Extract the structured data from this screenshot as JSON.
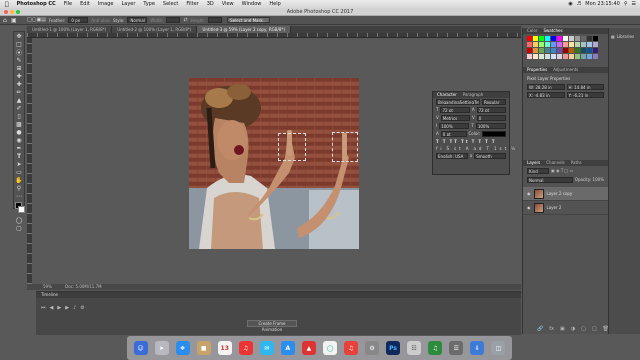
{
  "menubar": {
    "apple": "",
    "app": "Photoshop CC",
    "items": [
      "File",
      "Edit",
      "Image",
      "Layer",
      "Type",
      "Select",
      "Filter",
      "3D",
      "View",
      "Window",
      "Help"
    ],
    "clock": "Mon 23:15:40"
  },
  "titlebar": {
    "title": "Adobe Photoshop CC 2017"
  },
  "options": {
    "feather_label": "Feather:",
    "feather_value": "0 px",
    "antialias": "Anti-alias",
    "style_label": "Style:",
    "style_value": "Normal",
    "width_label": "Width:",
    "height_label": "Height:",
    "select_mask": "Select and Mask..."
  },
  "tabs": [
    {
      "label": "Untitled-1 @ 100% (Layer 1, RGB/8*)"
    },
    {
      "label": "Untitled-2 @ 100% (Layer 1, RGB/8*)"
    },
    {
      "label": "Untitled-3 @ 59% (Layer 2 copy, RGB/8*)"
    }
  ],
  "status": {
    "zoom": "59%",
    "doc": "Doc: 5.00M/11.7M"
  },
  "timeline": {
    "title": "Timeline",
    "create_button": "Create Frame Animation"
  },
  "right": {
    "color_tabs": [
      "Color",
      "Swatches"
    ],
    "props_tabs": [
      "Properties",
      "Adjustments"
    ],
    "props_title": "Pixel Layer Properties",
    "props_w": "W: 28.28 in",
    "props_h": "H: 14.84 in",
    "props_x": "X: -4.83 in",
    "props_y": "Y: -6.21 in",
    "layers_tabs": [
      "Layers",
      "Channels",
      "Paths"
    ],
    "kind": "Kind",
    "blend": "Normal",
    "opacity": "Opacity: 100%",
    "layers": [
      {
        "name": "Layer 2 copy"
      },
      {
        "name": "Layer 2"
      }
    ]
  },
  "rightstrip": {
    "libraries": "Libraries"
  },
  "character": {
    "tabs": [
      "Character",
      "Paragraph"
    ],
    "font": "BrigandinaSettingTree",
    "style": "Regular",
    "size": "72 pt",
    "leading": "72 pt",
    "kerning": "Metrics",
    "tracking": "0",
    "vscale": "100%",
    "hscale": "100%",
    "baseline": "0 pt",
    "color_label": "Color:",
    "language": "English: USA",
    "aa": "Smooth"
  }
}
